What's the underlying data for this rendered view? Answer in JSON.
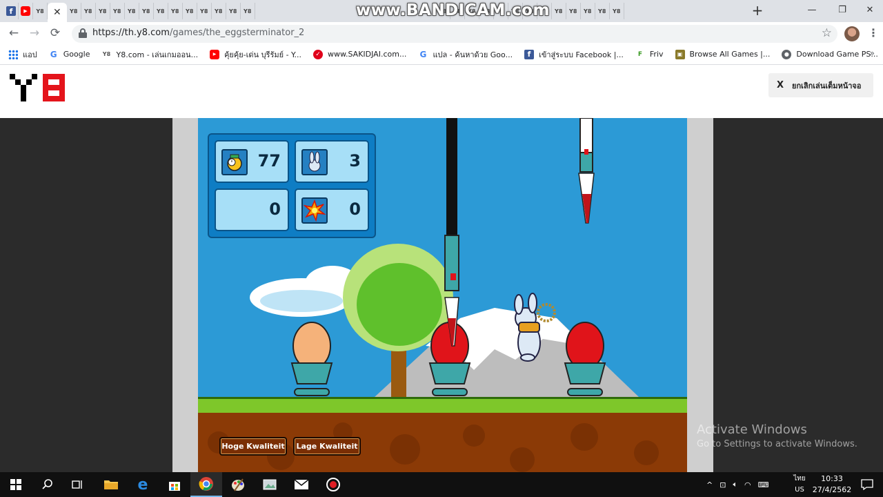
{
  "browser": {
    "recording_watermark": "www.BANDICAM.com",
    "tabs": [
      {
        "icon": "facebook-icon",
        "label": "f"
      },
      {
        "icon": "youtube-icon",
        "label": "▶"
      },
      {
        "icon": "y8-icon",
        "label": "Y8"
      }
    ],
    "mini_tab_label": "Y8",
    "active_tab_close": "✕",
    "new_tab": "+",
    "url_host": "https://th.y8.com",
    "url_path": "/games/the_eggsterminator_2",
    "window_controls": {
      "minimize": "—",
      "restore": "❐",
      "close": "✕"
    }
  },
  "bookmarks": [
    {
      "icon": "apps",
      "label": "แอป"
    },
    {
      "icon": "g",
      "label": "Google"
    },
    {
      "icon": "y8",
      "label": "Y8.com - เล่นเกมออน..."
    },
    {
      "icon": "yt",
      "label": "คุ้ยคุ้ย-เด่น บุรีรัมย์ - Y..."
    },
    {
      "icon": "sak",
      "label": "www.SAKIDJAI.com..."
    },
    {
      "icon": "g",
      "label": "แปล - ค้นหาด้วย Goo..."
    },
    {
      "icon": "fb",
      "label": "เข้าสู่ระบบ Facebook |..."
    },
    {
      "icon": "friv",
      "label": "Friv"
    },
    {
      "icon": "browse",
      "label": "Browse All Games |..."
    },
    {
      "icon": "dl",
      "label": "Download Game PS..."
    }
  ],
  "bookmarks_overflow": "»",
  "y8": {
    "exit_fullscreen_x": "X",
    "exit_fullscreen_label": "ยกเลิกเล่นเต็มหน้าจอ"
  },
  "game": {
    "hud": {
      "timer": "77",
      "bunnies": "3",
      "score": "0",
      "hits": "0"
    },
    "quality_high": "Hoge Kwaliteit",
    "quality_low": "Lage Kwaliteit",
    "colors": {
      "sky": "#2c9ad6",
      "grass": "#7ec72a",
      "dirt": "#8b3a06",
      "red_egg": "#e0141a",
      "plain_egg": "#f5b27a"
    }
  },
  "windows": {
    "activate_title": "Activate Windows",
    "activate_sub": "Go to Settings to activate Windows.",
    "lang_top": "ไทย",
    "lang_bottom": "US",
    "time": "10:33",
    "date": "27/4/2562"
  }
}
